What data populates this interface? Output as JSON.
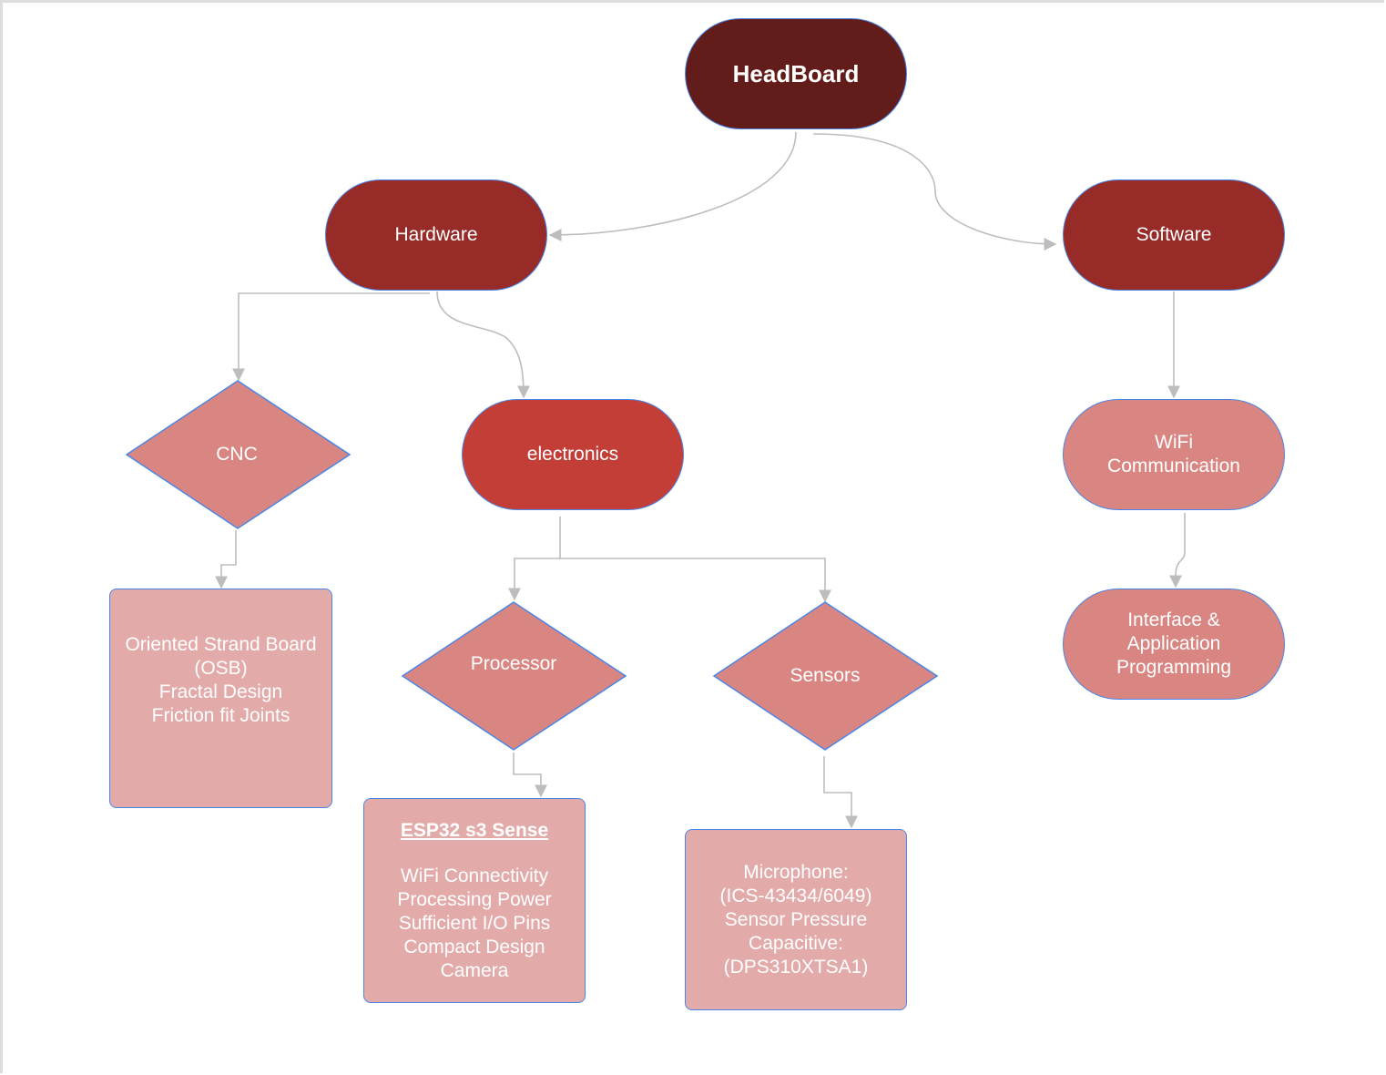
{
  "colors": {
    "root": "#621c1a",
    "level1": "#962b28",
    "electronics": "#c43e38",
    "level2": "#d98682",
    "detail": "#e3aaaa",
    "border": "#4a86e8",
    "connector": "#bdbdbd"
  },
  "nodes": {
    "headboard": "HeadBoard",
    "hardware": "Hardware",
    "software": "Software",
    "cnc": "CNC",
    "electronics": "electronics",
    "wifi": [
      "WiFi",
      "Communication"
    ],
    "interface": [
      "Interface &",
      "Application",
      "Programming"
    ],
    "osb": [
      "Oriented Strand Board",
      "(OSB)",
      "Fractal Design",
      "Friction fit Joints"
    ],
    "processor": "Processor",
    "sensors": "Sensors",
    "esp": {
      "title": "ESP32 s3 Sense",
      "lines": [
        "WiFi Connectivity",
        "Processing Power",
        "Sufficient I/O Pins",
        "Compact Design",
        "Camera"
      ]
    },
    "sensor_details": [
      "Microphone:",
      "(ICS-43434/6049)",
      "Sensor Pressure",
      "Capacitive:",
      "(DPS310XTSA1)"
    ]
  }
}
